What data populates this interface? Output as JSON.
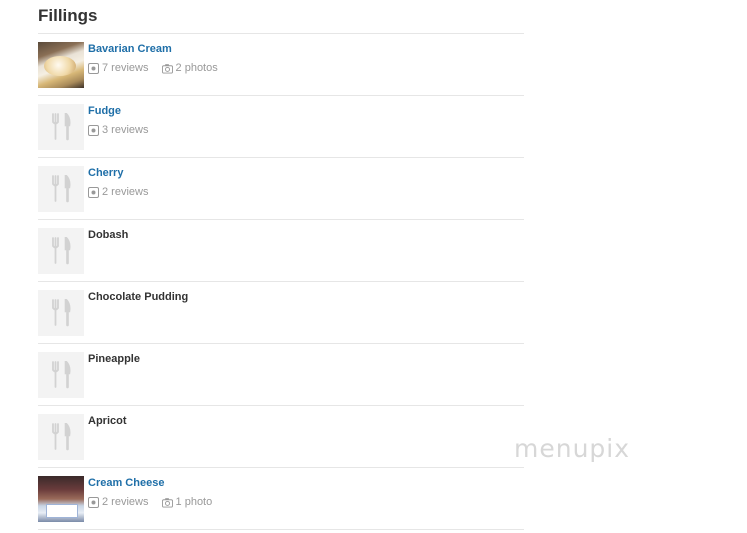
{
  "section": {
    "title": "Fillings"
  },
  "items": [
    {
      "name": "Bavarian Cream",
      "linked": true,
      "thumbnail": "photo",
      "reviews": "7 reviews",
      "photos": "2 photos"
    },
    {
      "name": "Fudge",
      "linked": true,
      "thumbnail": "placeholder",
      "reviews": "3 reviews"
    },
    {
      "name": "Cherry",
      "linked": true,
      "thumbnail": "placeholder",
      "reviews": "2 reviews"
    },
    {
      "name": "Dobash",
      "linked": false,
      "thumbnail": "placeholder"
    },
    {
      "name": "Chocolate Pudding",
      "linked": false,
      "thumbnail": "placeholder"
    },
    {
      "name": "Pineapple",
      "linked": false,
      "thumbnail": "placeholder"
    },
    {
      "name": "Apricot",
      "linked": false,
      "thumbnail": "placeholder"
    },
    {
      "name": "Cream Cheese",
      "linked": true,
      "thumbnail": "photo",
      "reviews": "2 reviews",
      "photos": "1 photo"
    }
  ],
  "icons": {
    "placeholder": "fork-knife-icon",
    "reviews": "review-icon",
    "photos": "camera-icon"
  },
  "colors": {
    "link": "#1f6fa8",
    "meta": "#999999",
    "divider": "#e6e6e6"
  },
  "watermark": {
    "text": "menupix"
  }
}
